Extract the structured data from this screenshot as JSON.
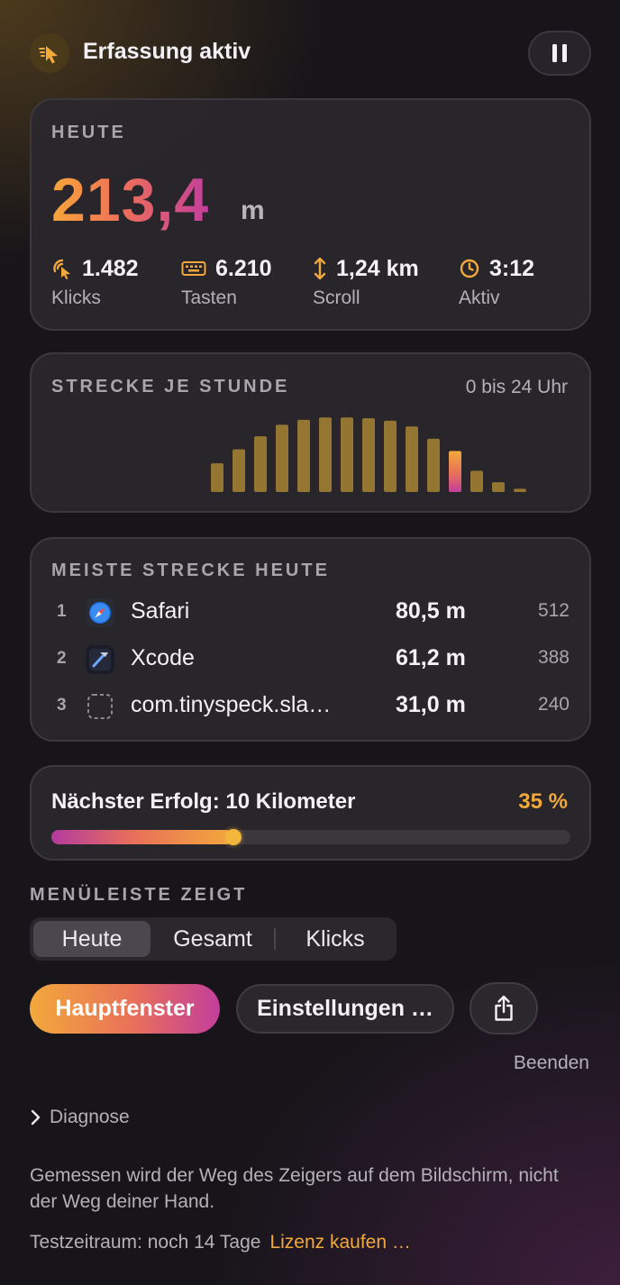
{
  "header": {
    "title": "Erfassung aktiv",
    "icon": "cursor-icon",
    "pause_icon": "pause-icon"
  },
  "today": {
    "caption": "HEUTE",
    "distance": "213,4",
    "unit": "m",
    "stats": [
      {
        "icon": "click-icon",
        "value": "1.482",
        "label": "Klicks"
      },
      {
        "icon": "keyboard-icon",
        "value": "6.210",
        "label": "Tasten"
      },
      {
        "icon": "scroll-arrows-icon",
        "value": "1,24 km",
        "label": "Scroll"
      },
      {
        "icon": "clock-icon",
        "value": "3:12",
        "label": "Aktiv"
      }
    ]
  },
  "hourly": {
    "caption": "STRECKE JE STUNDE",
    "range": "0 bis 24 Uhr",
    "colors": {
      "bar": "#957532",
      "current": "#e8705a"
    }
  },
  "chart_data": {
    "type": "bar",
    "categories": [
      "0",
      "1",
      "2",
      "3",
      "4",
      "5",
      "6",
      "7",
      "8",
      "9",
      "10",
      "11",
      "12",
      "13",
      "14",
      "15",
      "16",
      "17",
      "18",
      "19",
      "20",
      "21",
      "22",
      "23"
    ],
    "values": [
      0,
      0,
      0,
      0,
      0,
      0,
      0,
      0,
      35,
      52,
      68,
      82,
      88,
      91,
      91,
      90,
      87,
      80,
      65,
      50,
      26,
      12,
      4,
      0
    ],
    "current_index": 19,
    "ylim": [
      0,
      100
    ],
    "grid": false,
    "title": "STRECKE JE STUNDE"
  },
  "top_apps": {
    "caption": "MEISTE STRECKE HEUTE",
    "rows": [
      {
        "rank": "1",
        "icon": "safari-icon",
        "name": "Safari",
        "distance": "80,5 m",
        "count": "512"
      },
      {
        "rank": "2",
        "icon": "xcode-icon",
        "name": "Xcode",
        "distance": "61,2 m",
        "count": "388"
      },
      {
        "rank": "3",
        "icon": "placeholder-app-icon",
        "name": "com.tinyspeck.sla…",
        "distance": "31,0 m",
        "count": "240"
      }
    ]
  },
  "achievement": {
    "title": "Nächster Erfolg: 10 Kilometer",
    "percent": "35 %",
    "progress": 0.35
  },
  "menubar": {
    "caption": "MENÜLEISTE ZEIGT",
    "options": [
      "Heute",
      "Gesamt",
      "Klicks"
    ],
    "selected": "Heute"
  },
  "actions": {
    "main_window": "Hauptfenster",
    "settings": "Einstellungen …",
    "share_icon": "share-icon",
    "quit": "Beenden"
  },
  "diagnose": {
    "label": "Diagnose",
    "icon": "chevron-right-icon"
  },
  "note": "Gemessen wird der Weg des Zeigers auf dem Bildschirm, nicht der Weg deiner Hand.",
  "trial": {
    "text": "Testzeitraum: noch 14 Tage",
    "link": "Lizenz kaufen …"
  },
  "colors": {
    "accent_orange": "#f2a93b",
    "accent_pink": "#c23e9c",
    "accent_coral": "#e8705a"
  }
}
